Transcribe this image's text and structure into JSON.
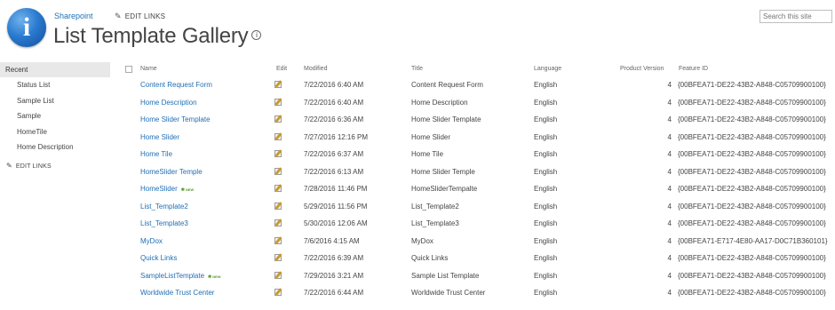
{
  "header": {
    "site_link": "Sharepoint",
    "edit_links": "EDIT LINKS",
    "title": "List Template Gallery",
    "search_placeholder": "Search this site"
  },
  "nav": {
    "heading": "Recent",
    "items": [
      "Status List",
      "Sample List",
      "Sample",
      "HomeTile",
      "Home Description"
    ],
    "edit_links": "EDIT LINKS"
  },
  "table": {
    "columns": {
      "name": "Name",
      "edit": "Edit",
      "modified": "Modified",
      "title": "Title",
      "language": "Language",
      "product_version": "Product Version",
      "feature_id": "Feature ID"
    },
    "new_badge": "NEW",
    "rows": [
      {
        "name": "Content Request Form",
        "modified": "7/22/2016 6:40 AM",
        "title": "Content Request Form",
        "language": "English",
        "version": "4",
        "feature_id": "{00BFEA71-DE22-43B2-A848-C05709900100}",
        "is_new": false
      },
      {
        "name": "Home Description",
        "modified": "7/22/2016 6:40 AM",
        "title": "Home Description",
        "language": "English",
        "version": "4",
        "feature_id": "{00BFEA71-DE22-43B2-A848-C05709900100}",
        "is_new": false
      },
      {
        "name": "Home Slider Template",
        "modified": "7/22/2016 6:36 AM",
        "title": "Home Slider Template",
        "language": "English",
        "version": "4",
        "feature_id": "{00BFEA71-DE22-43B2-A848-C05709900100}",
        "is_new": false
      },
      {
        "name": "Home Slider",
        "modified": "7/27/2016 12:16 PM",
        "title": "Home Slider",
        "language": "English",
        "version": "4",
        "feature_id": "{00BFEA71-DE22-43B2-A848-C05709900100}",
        "is_new": false
      },
      {
        "name": "Home Tile",
        "modified": "7/22/2016 6:37 AM",
        "title": "Home Tile",
        "language": "English",
        "version": "4",
        "feature_id": "{00BFEA71-DE22-43B2-A848-C05709900100}",
        "is_new": false
      },
      {
        "name": "HomeSlider Temple",
        "modified": "7/22/2016 6:13 AM",
        "title": "Home Slider Temple",
        "language": "English",
        "version": "4",
        "feature_id": "{00BFEA71-DE22-43B2-A848-C05709900100}",
        "is_new": false
      },
      {
        "name": "HomeSlider",
        "modified": "7/28/2016 11:46 PM",
        "title": "HomeSliderTempalte",
        "language": "English",
        "version": "4",
        "feature_id": "{00BFEA71-DE22-43B2-A848-C05709900100}",
        "is_new": true
      },
      {
        "name": "List_Template2",
        "modified": "5/29/2016 11:56 PM",
        "title": "List_Template2",
        "language": "English",
        "version": "4",
        "feature_id": "{00BFEA71-DE22-43B2-A848-C05709900100}",
        "is_new": false
      },
      {
        "name": "List_Template3",
        "modified": "5/30/2016 12:06 AM",
        "title": "List_Template3",
        "language": "English",
        "version": "4",
        "feature_id": "{00BFEA71-DE22-43B2-A848-C05709900100}",
        "is_new": false
      },
      {
        "name": "MyDox",
        "modified": "7/6/2016 4:15 AM",
        "title": "MyDox",
        "language": "English",
        "version": "4",
        "feature_id": "{00BFEA71-E717-4E80-AA17-D0C71B360101}",
        "is_new": false
      },
      {
        "name": "Quick Links",
        "modified": "7/22/2016 6:39 AM",
        "title": "Quick Links",
        "language": "English",
        "version": "4",
        "feature_id": "{00BFEA71-DE22-43B2-A848-C05709900100}",
        "is_new": false
      },
      {
        "name": "SampleListTemplate",
        "modified": "7/29/2016 3:21 AM",
        "title": "Sample List Template",
        "language": "English",
        "version": "4",
        "feature_id": "{00BFEA71-DE22-43B2-A848-C05709900100}",
        "is_new": true
      },
      {
        "name": "Worldwide Trust Center",
        "modified": "7/22/2016 6:44 AM",
        "title": "Worldwide Trust Center",
        "language": "English",
        "version": "4",
        "feature_id": "{00BFEA71-DE22-43B2-A848-C05709900100}",
        "is_new": false
      }
    ]
  }
}
